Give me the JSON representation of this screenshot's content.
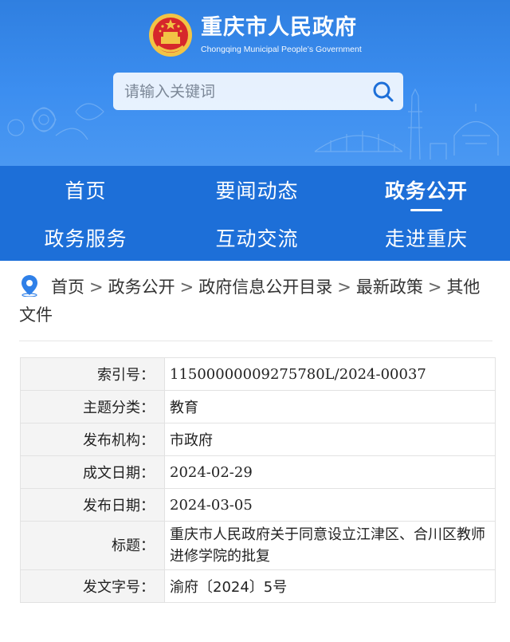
{
  "header": {
    "title_cn": "重庆市人民政府",
    "title_en": "Chongqing Municipal People’s Government",
    "search_placeholder": "请输入关键词",
    "emblem_icon": "national-emblem-icon",
    "search_icon": "search-icon",
    "colors": {
      "banner": "#3a8bee",
      "nav": "#1d6fd8"
    }
  },
  "nav": {
    "items": [
      {
        "label": "首页",
        "active": false
      },
      {
        "label": "要闻动态",
        "active": false
      },
      {
        "label": "政务公开",
        "active": true
      },
      {
        "label": "政务服务",
        "active": false
      },
      {
        "label": "互动交流",
        "active": false
      },
      {
        "label": "走进重庆",
        "active": false
      }
    ]
  },
  "breadcrumb": {
    "icon": "location-pin-icon",
    "items": [
      "首页",
      "政务公开",
      "政府信息公开目录",
      "最新政策",
      "其他文件"
    ],
    "separator": ">"
  },
  "info": {
    "rows": [
      {
        "label": "索引号：",
        "value": "11500000009275780L/2024-00037"
      },
      {
        "label": "主题分类：",
        "value": "教育"
      },
      {
        "label": "发布机构：",
        "value": "市政府"
      },
      {
        "label": "成文日期：",
        "value": "2024-02-29"
      },
      {
        "label": "发布日期：",
        "value": "2024-03-05"
      },
      {
        "label": "标题：",
        "value": "重庆市人民政府关于同意设立江津区、合川区教师进修学院的批复"
      },
      {
        "label": "发文字号：",
        "value": "渝府〔2024〕5号"
      }
    ]
  }
}
